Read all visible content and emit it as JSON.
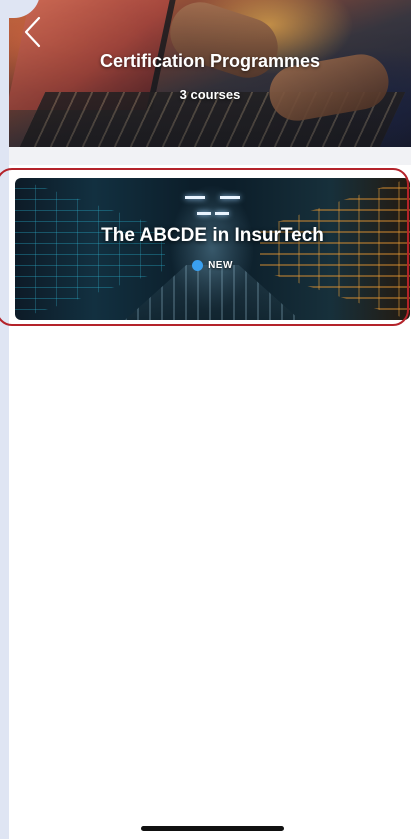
{
  "header": {
    "title": "Certification Programmes",
    "subtitle": "3 courses",
    "back_icon": "chevron-left-icon"
  },
  "courses": [
    {
      "title": "The ABCDE in InsurTech",
      "badge": "NEW",
      "badge_color": "#3aa0f0"
    }
  ],
  "colors": {
    "highlight_outline": "#b4232a",
    "background": "#ffffff",
    "side_panel": "#dfe5f3"
  }
}
